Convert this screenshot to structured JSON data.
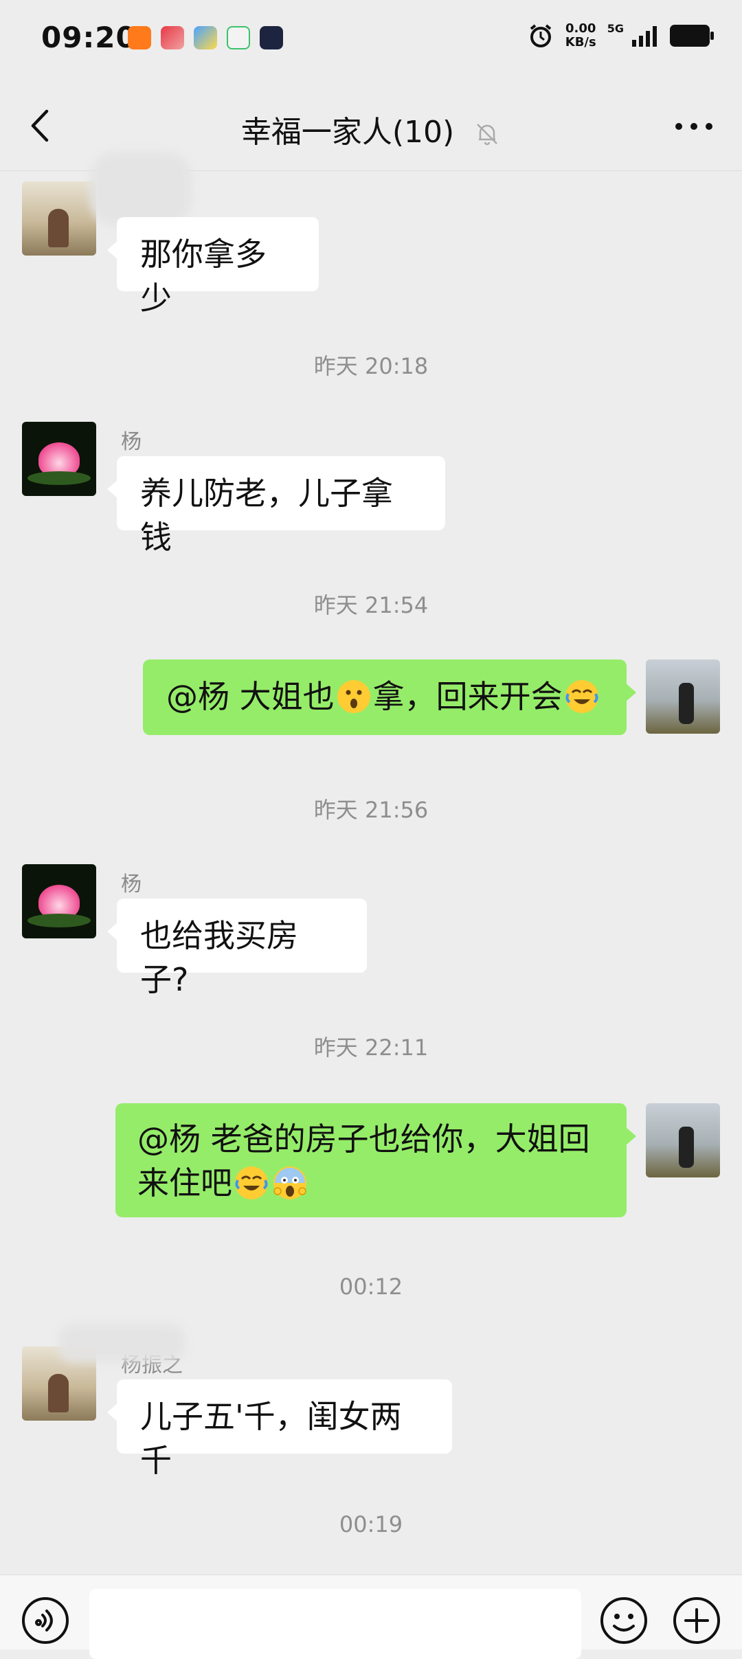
{
  "status_bar": {
    "time": "09:20",
    "net_speed_value": "0.00",
    "net_speed_unit": "KB/s",
    "network": "5G",
    "app_icons": [
      "app-orange-icon",
      "app-red-game-icon",
      "app-blue-icon",
      "app-green-icon",
      "app-dark-video-icon"
    ]
  },
  "header": {
    "title": "幸福一家人(10)",
    "back_icon": "chevron-left-icon",
    "mute_icon": "bell-off-icon",
    "more_icon": "more-dots-icon"
  },
  "messages": [
    {
      "type": "incoming",
      "sender": "",
      "text": "那你拿多少"
    },
    {
      "type": "time",
      "text": "昨天 20:18"
    },
    {
      "type": "incoming",
      "sender": "杨",
      "text": "养儿防老，儿子拿钱"
    },
    {
      "type": "time",
      "text": "昨天 21:54"
    },
    {
      "type": "outgoing",
      "text_parts": [
        "@杨  大姐也",
        "拿，回来开会"
      ],
      "emojis": [
        "astonished-emoji",
        "crying-laughing-emoji"
      ]
    },
    {
      "type": "time",
      "text": "昨天 21:56"
    },
    {
      "type": "incoming",
      "sender": "杨",
      "text": "也给我买房子?"
    },
    {
      "type": "time",
      "text": "昨天 22:11"
    },
    {
      "type": "outgoing",
      "text_line1": "@杨  老爸的房子也给你，大姐回",
      "text_line2": "来住吧",
      "emojis": [
        "crying-laughing-emoji",
        "screaming-emoji"
      ]
    },
    {
      "type": "time",
      "text": "00:12"
    },
    {
      "type": "incoming",
      "sender": "杨振之",
      "text": "儿子五'千，闺女两千"
    },
    {
      "type": "time",
      "text": "00:19"
    }
  ],
  "input_bar": {
    "voice_icon": "voice-icon",
    "emoji_icon": "emoji-smile-icon",
    "plus_icon": "plus-circle-icon"
  },
  "colors": {
    "background": "#ededed",
    "outgoing_bubble": "#95ec69",
    "incoming_bubble": "#ffffff"
  }
}
